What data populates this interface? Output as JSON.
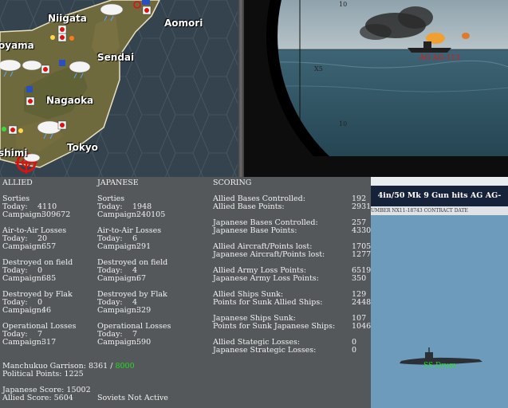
{
  "map": {
    "cities": [
      "Niigata",
      "Aomori",
      "oyama",
      "Sendai",
      "Nagaoka",
      "Tokyo",
      "shimi"
    ]
  },
  "periscope": {
    "ticks": [
      "10",
      "X5",
      "10"
    ],
    "target_label": "AG AG-113"
  },
  "report": {
    "allied": {
      "header": "ALLIED",
      "sorties": {
        "title": "Sorties",
        "today": "4110",
        "campaign": "309672"
      },
      "air_losses": {
        "title": "Air-to-Air Losses",
        "today": "20",
        "campaign": "657"
      },
      "destroyed_field": {
        "title": "Destroyed on field",
        "today": "0",
        "campaign": "685"
      },
      "destroyed_flak": {
        "title": "Destroyed by Flak",
        "today": "0",
        "campaign": "46"
      },
      "operational": {
        "title": "Operational Losses",
        "today": "7",
        "campaign": "317"
      }
    },
    "japanese": {
      "header": "JAPANESE",
      "sorties": {
        "title": "Sorties",
        "today": "1948",
        "campaign": "240105"
      },
      "air_losses": {
        "title": "Air-to-Air Losses",
        "today": "6",
        "campaign": "291"
      },
      "destroyed_field": {
        "title": "Destroyed on field",
        "today": "4",
        "campaign": "67"
      },
      "destroyed_flak": {
        "title": "Destroyed by Flak",
        "today": "4",
        "campaign": "329"
      },
      "operational": {
        "title": "Operational Losses",
        "today": "7",
        "campaign": "590"
      }
    },
    "labels": {
      "today": "Today:",
      "campaign": "Campaign:"
    },
    "scoring": {
      "header": "SCORING",
      "groups": [
        [
          {
            "label": "Allied Bases Controlled:",
            "value": "192"
          },
          {
            "label": "Allied Base Points:",
            "value": "2931"
          }
        ],
        [
          {
            "label": "Japanese Bases Controlled:",
            "value": "257"
          },
          {
            "label": "Japanese Base Points:",
            "value": "4330"
          }
        ],
        [
          {
            "label": "Allied Aircraft/Points lost:",
            "value": "1705"
          },
          {
            "label": "Japanese Aircraft/Points lost:",
            "value": "1277"
          }
        ],
        [
          {
            "label": "Allied Army Loss Points:",
            "value": "6519"
          },
          {
            "label": "Japanese Army Loss Points:",
            "value": "350"
          }
        ],
        [
          {
            "label": "Allied Ships Sunk:",
            "value": "129"
          },
          {
            "label": "Points for Sunk Allied Ships:",
            "value": "2448"
          }
        ],
        [
          {
            "label": "Japanese Ships Sunk:",
            "value": "107"
          },
          {
            "label": "Points for Sunk Japanese Ships:",
            "value": "1046"
          }
        ],
        [
          {
            "label": "Allied Stategic Losses:",
            "value": "0"
          },
          {
            "label": "Japanese Strategic Losses:",
            "value": "0"
          }
        ]
      ]
    },
    "footer": {
      "garrison_label": "Manchukuo Garrison:",
      "garrison_value": "8361",
      "garrison_sep": "/",
      "garrison_required": "8000",
      "political": "Political Points: 1225",
      "japanese_score": "Japanese Score: 15002",
      "allied_score": "Allied Score: 5604",
      "soviets": "Soviets Not Active"
    }
  },
  "ship_panel": {
    "message": "4in/50 Mk 9 Gun hits AG AG-113",
    "doc_strip": "UMBER   NX11-18743                CONTRACT DATE",
    "sub_label": "SS Drum"
  },
  "colors": {
    "required_garrison": "#22dd22",
    "target_label": "#e01818",
    "sub_label": "#2bdc2b"
  }
}
